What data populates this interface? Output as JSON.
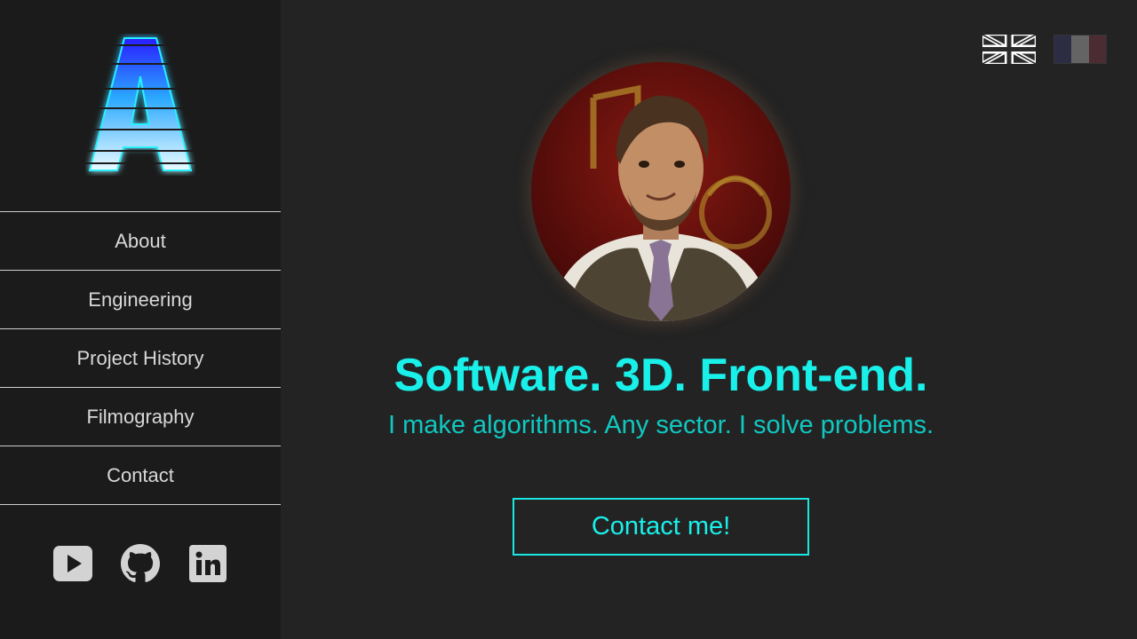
{
  "sidebar": {
    "logo": {
      "letter": "A",
      "icon": "logo-letter-a-icon"
    },
    "nav": [
      {
        "label": "About"
      },
      {
        "label": "Engineering"
      },
      {
        "label": "Project History"
      },
      {
        "label": "Filmography"
      },
      {
        "label": "Contact"
      }
    ],
    "socials": [
      {
        "icon": "youtube-icon"
      },
      {
        "icon": "github-icon"
      },
      {
        "icon": "linkedin-icon"
      }
    ]
  },
  "languages": [
    {
      "icon": "uk-flag-icon",
      "active": true
    },
    {
      "icon": "france-flag-icon",
      "active": false
    }
  ],
  "hero": {
    "avatar": "profile-photo",
    "headline": "Software. 3D. Front-end.",
    "subline": "I make algorithms. Any sector. I solve problems.",
    "cta_label": "Contact me!"
  },
  "colors": {
    "accent": "#19f0ea",
    "sidebar_bg": "#1b1b1b",
    "main_bg": "#232323"
  }
}
